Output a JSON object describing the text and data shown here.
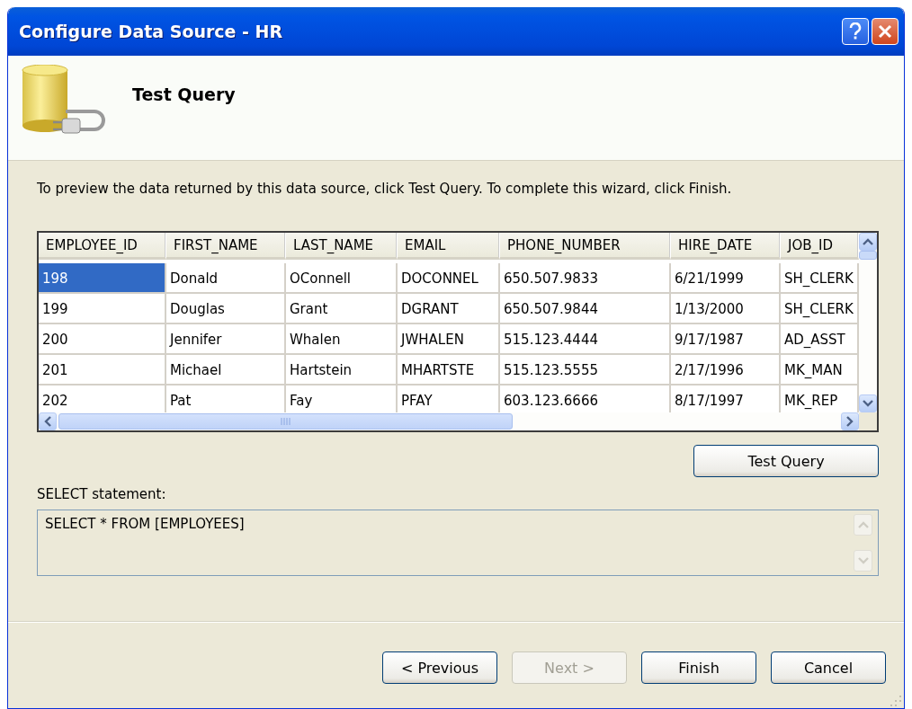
{
  "window": {
    "title": "Configure Data Source - HR"
  },
  "header": {
    "title": "Test Query"
  },
  "instruction": "To preview the data returned by this data source, click Test Query. To complete this wizard, click Finish.",
  "table": {
    "columns": [
      "EMPLOYEE_ID",
      "FIRST_NAME",
      "LAST_NAME",
      "EMAIL",
      "PHONE_NUMBER",
      "HIRE_DATE",
      "JOB_ID"
    ],
    "rows": [
      {
        "selected": true,
        "cells": [
          "198",
          "Donald",
          "OConnell",
          "DOCONNEL",
          "650.507.9833",
          "6/21/1999",
          "SH_CLERK"
        ]
      },
      {
        "selected": false,
        "cells": [
          "199",
          "Douglas",
          "Grant",
          "DGRANT",
          "650.507.9844",
          "1/13/2000",
          "SH_CLERK"
        ]
      },
      {
        "selected": false,
        "cells": [
          "200",
          "Jennifer",
          "Whalen",
          "JWHALEN",
          "515.123.4444",
          "9/17/1987",
          "AD_ASST"
        ]
      },
      {
        "selected": false,
        "cells": [
          "201",
          "Michael",
          "Hartstein",
          "MHARTSTE",
          "515.123.5555",
          "2/17/1996",
          "MK_MAN"
        ]
      },
      {
        "selected": false,
        "cells": [
          "202",
          "Pat",
          "Fay",
          "PFAY",
          "603.123.6666",
          "8/17/1997",
          "MK_REP"
        ]
      }
    ]
  },
  "test_query_button": "Test Query",
  "select_statement": {
    "label": "SELECT statement:",
    "value": "SELECT * FROM [EMPLOYEES]"
  },
  "buttons": [
    {
      "label": "< Previous",
      "disabled": false
    },
    {
      "label": "Next >",
      "disabled": true
    },
    {
      "label": "Finish",
      "disabled": false
    },
    {
      "label": "Cancel",
      "disabled": false
    }
  ]
}
